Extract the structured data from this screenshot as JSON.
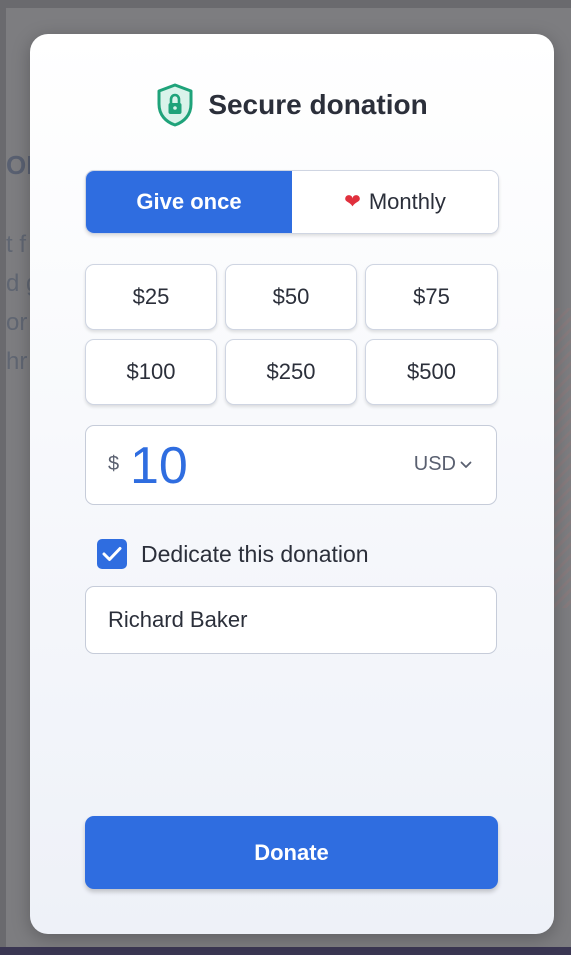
{
  "modal": {
    "title": "Secure donation",
    "title_icon": "lock-shield-icon"
  },
  "frequency": {
    "options": [
      {
        "label": "Give once",
        "selected": true
      },
      {
        "label": "Monthly",
        "selected": false,
        "icon": "heart-icon"
      }
    ]
  },
  "amounts": [
    "$25",
    "$50",
    "$75",
    "$100",
    "$250",
    "$500"
  ],
  "custom_amount": {
    "currency_symbol": "$",
    "value": "10",
    "currency": "USD"
  },
  "dedicate": {
    "label": "Dedicate this donation",
    "checked": true,
    "name_value": "Richard Baker"
  },
  "donate_button": {
    "label": "Donate"
  },
  "colors": {
    "primary": "#2f6de0",
    "heart": "#e0303d",
    "shield": "#1fa37a"
  },
  "background_page": {
    "visible_fragments": [
      "OI",
      "t f",
      "d g",
      "or",
      "hr"
    ]
  }
}
